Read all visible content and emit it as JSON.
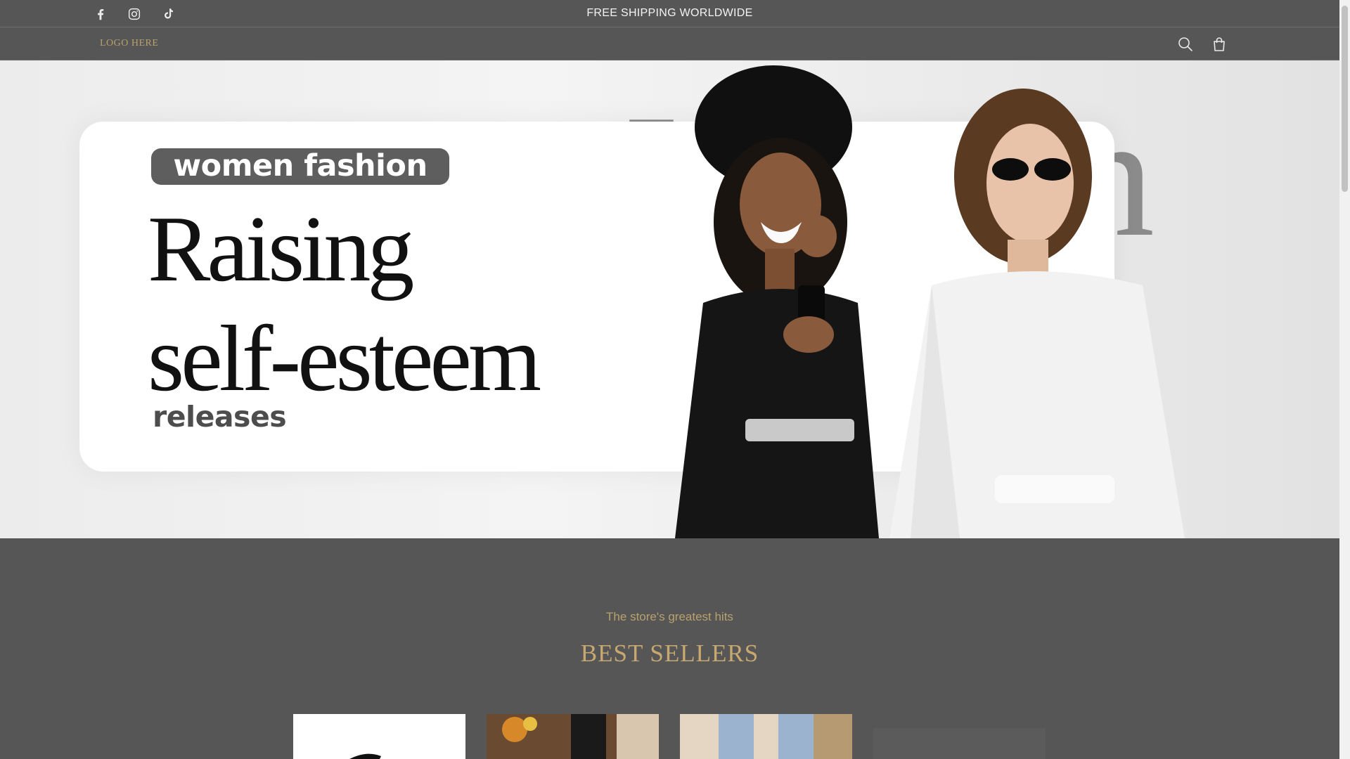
{
  "announcement": {
    "text": "FREE SHIPPING WORLDWIDE",
    "social": [
      "facebook-icon",
      "instagram-icon",
      "tiktok-icon"
    ]
  },
  "header": {
    "logo": "LOGO HERE",
    "icons": [
      "search-icon",
      "cart-icon"
    ]
  },
  "hero": {
    "tag": "women fashion",
    "headline_line1": "Raising",
    "headline_line2": "self-esteem",
    "subline": "releases",
    "background_word": "Woman"
  },
  "best_sellers": {
    "kicker": "The store's greatest hits",
    "title": "BEST SELLERS"
  },
  "colors": {
    "background": "#565656",
    "accent_gold": "#c8a871",
    "announcement_text": "#f3f3f3"
  }
}
